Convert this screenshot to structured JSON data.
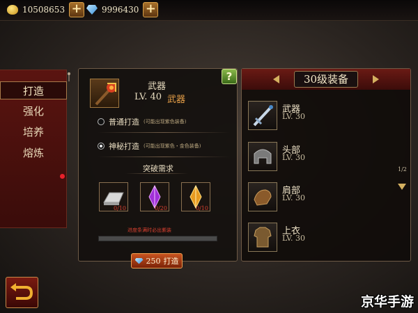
{
  "top_bar": {
    "gold": "10508653",
    "gems": "9996430"
  },
  "left_menu": {
    "items": [
      {
        "label": "打造",
        "active": true
      },
      {
        "label": "强化",
        "badge": true
      },
      {
        "label": "培养"
      },
      {
        "label": "熔炼"
      }
    ]
  },
  "forge_panel": {
    "help_label": "?",
    "item_name": "武器",
    "item_level": "LV. 40",
    "item_type": "武器",
    "options": [
      {
        "label": "普通打造",
        "note": "(可能出现紫色装备)",
        "selected": false
      },
      {
        "label": "神秘打造",
        "note": "(可能出现紫色・金色装备)",
        "selected": true
      }
    ],
    "materials_title": "突破需求",
    "materials": [
      {
        "icon": "silver-ingot-icon",
        "count": "0/10"
      },
      {
        "icon": "purple-crystal-icon",
        "count": "0/20"
      },
      {
        "icon": "gold-crystal-icon",
        "count": "0/10"
      }
    ],
    "progress_label": "进度条满时必出紫装",
    "progress": 0,
    "forge_cost": "250",
    "forge_label": "打造"
  },
  "equipment_panel": {
    "title": "30级装备",
    "page": "1/2",
    "items": [
      {
        "name": "武器",
        "level": "LV. 30",
        "icon": "sword-icon"
      },
      {
        "name": "头部",
        "level": "LV. 30",
        "icon": "helmet-icon"
      },
      {
        "name": "肩部",
        "level": "LV. 30",
        "icon": "shoulder-armor-icon"
      },
      {
        "name": "上衣",
        "level": "LV. 30",
        "icon": "chest-armor-icon"
      }
    ]
  },
  "watermark": "京华手游",
  "colors": {
    "accent_gold": "#d4b060",
    "menu_red": "#5a1410",
    "warning_red": "#d84030"
  }
}
